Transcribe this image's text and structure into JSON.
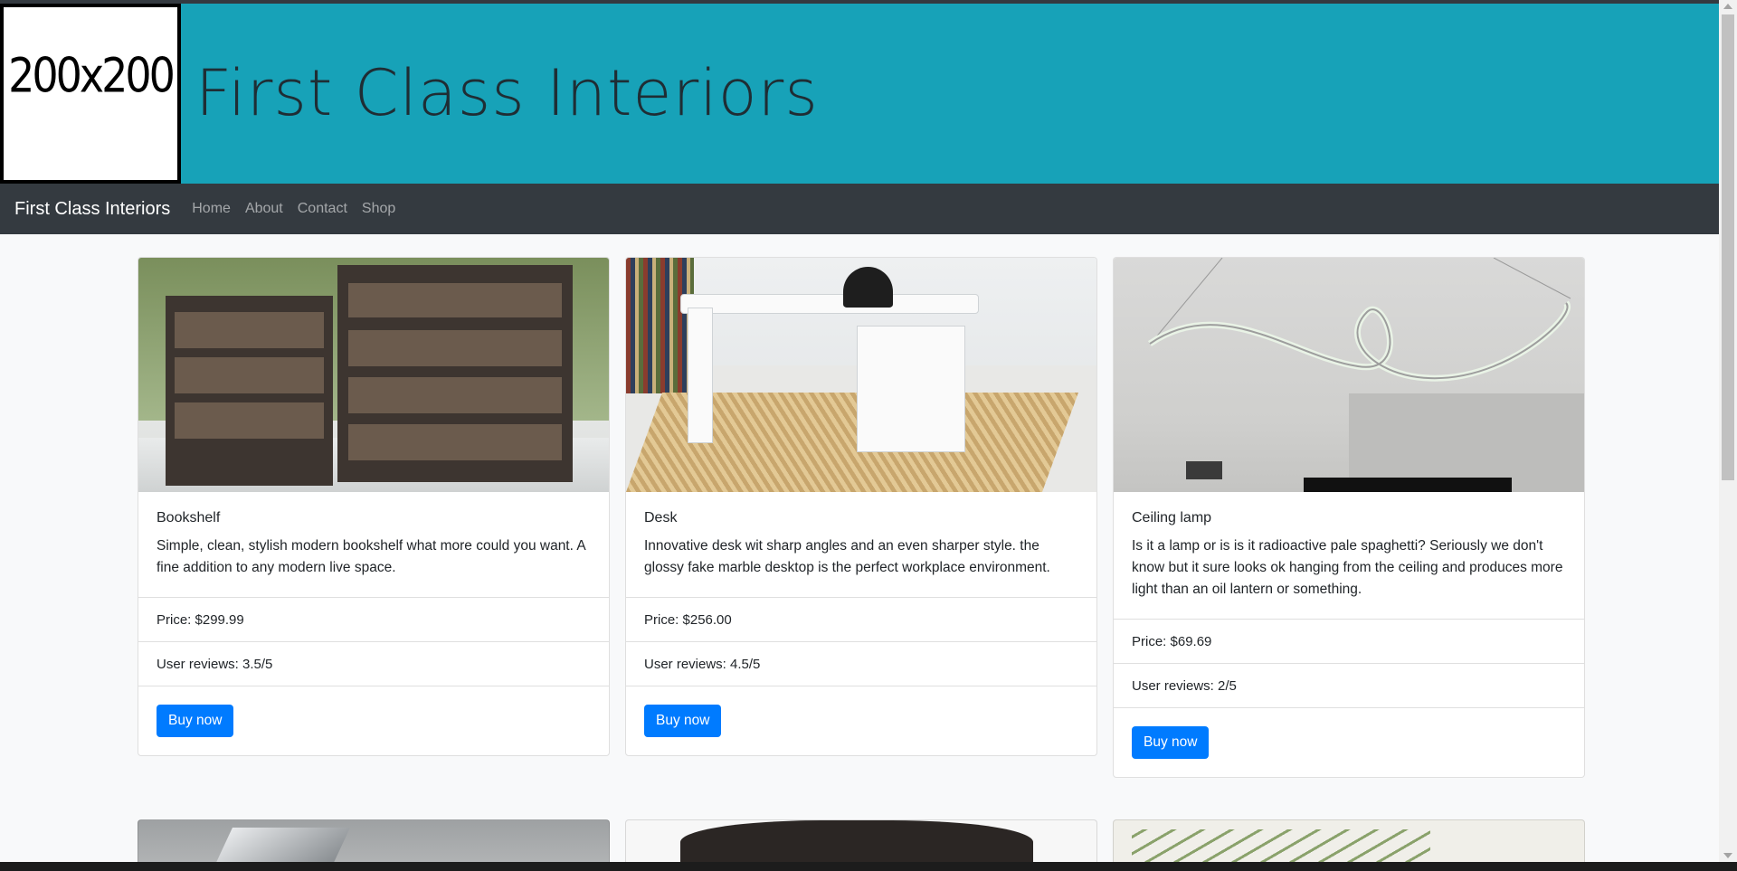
{
  "header": {
    "logo_text": "200x200",
    "title": "First Class Interiors"
  },
  "navbar": {
    "brand": "First Class Interiors",
    "links": [
      "Home",
      "About",
      "Contact",
      "Shop"
    ]
  },
  "products": [
    {
      "title": "Bookshelf",
      "description": "Simple, clean, stylish modern bookshelf what more could you want. A fine addition to any modern live space.",
      "price": "Price: $299.99",
      "reviews": "User reviews: 3.5/5",
      "button": "Buy now",
      "image_icon": "bookshelf-image"
    },
    {
      "title": "Desk",
      "description": "Innovative desk wit sharp angles and an even sharper style. the glossy fake marble desktop is the perfect workplace environment.",
      "price": "Price: $256.00",
      "reviews": "User reviews: 4.5/5",
      "button": "Buy now",
      "image_icon": "desk-image"
    },
    {
      "title": "Ceiling lamp",
      "description": "Is it a lamp or is is it radioactive pale spaghetti? Seriously we don't know but it sure looks ok hanging from the ceiling and produces more light than an oil lantern or something.",
      "price": "Price: $69.69",
      "reviews": "User reviews: 2/5",
      "button": "Buy now",
      "image_icon": "ceiling-lamp-image"
    }
  ],
  "colors": {
    "header_bg": "#17a2b8",
    "navbar_bg": "#343a40",
    "button_bg": "#007bff",
    "page_bg": "#f8f9fa"
  }
}
